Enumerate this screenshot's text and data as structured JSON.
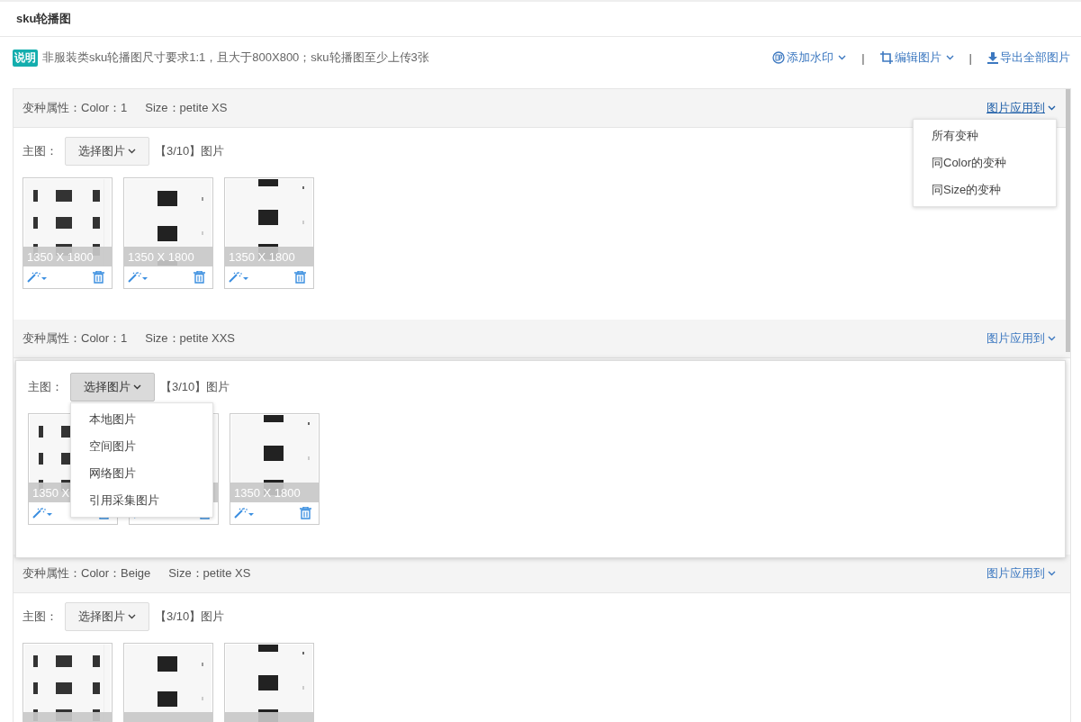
{
  "page": {
    "title": "sku轮播图"
  },
  "notice": {
    "badge": "说明",
    "text": "非服装类sku轮播图尺寸要求1:1，且大于800X800；sku轮播图至少上传3张"
  },
  "toolbar": [
    {
      "kind": "watermark",
      "label": "添加水印",
      "dropdown": true
    },
    {
      "kind": "edit",
      "label": "编辑图片",
      "dropdown": true
    },
    {
      "kind": "export",
      "label": "导出全部图片",
      "dropdown": false
    }
  ],
  "separator": "|",
  "variants": [
    {
      "attr_label": "变种属性：",
      "color_attr": "Color：1",
      "size_attr": "Size：petite XS",
      "apply_label": "图片应用到",
      "apply_menu_open": true,
      "highlighted": false,
      "main_label": "主图：",
      "select_label": "选择图片",
      "select_menu_open": false,
      "count": "【3/10】图片",
      "images": [
        {
          "kind": "picture",
          "size": "1350 X 1800"
        },
        {
          "kind": "picture",
          "size": "1350 X 1800"
        },
        {
          "kind": "picture",
          "size": "1350 X 1800"
        }
      ]
    },
    {
      "attr_label": "变种属性：",
      "color_attr": "Color：1",
      "size_attr": "Size：petite XXS",
      "apply_label": "图片应用到",
      "apply_menu_open": false,
      "highlighted": true,
      "main_label": "主图：",
      "select_label": "选择图片",
      "select_menu_open": true,
      "count": "【3/10】图片",
      "images": [
        {
          "kind": "picture",
          "size": "1350 X"
        },
        {
          "kind": "picture"
        },
        {
          "kind": "picture",
          "size": "1350 X 1800"
        }
      ]
    },
    {
      "attr_label": "变种属性：",
      "color_attr": "Color：Beige",
      "size_attr": "Size：petite XS",
      "apply_label": "图片应用到",
      "apply_menu_open": false,
      "highlighted": false,
      "main_label": "主图：",
      "select_label": "选择图片",
      "select_menu_open": false,
      "count": "【3/10】图片",
      "images": [
        {
          "kind": "picture"
        },
        {
          "kind": "picture"
        },
        {
          "kind": "picture"
        }
      ]
    }
  ],
  "apply_menu": [
    "所有变种",
    "同Color的变种",
    "同Size的变种"
  ],
  "select_menu": [
    "本地图片",
    "空间图片",
    "网络图片",
    "引用采集图片"
  ]
}
